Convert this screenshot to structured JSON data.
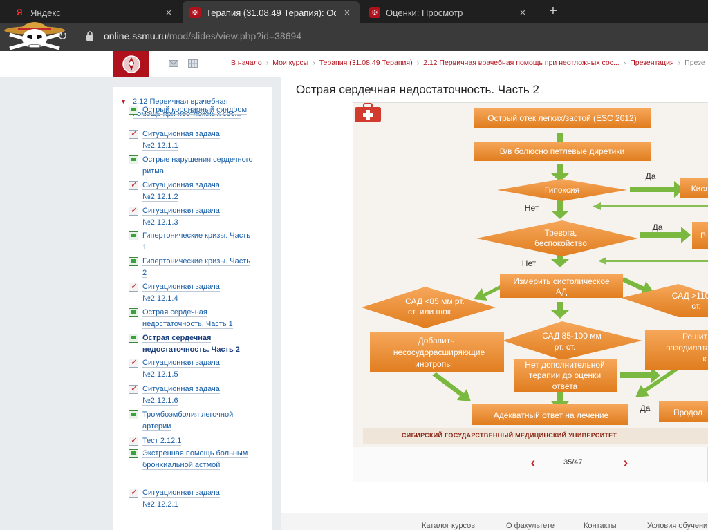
{
  "browser": {
    "tabs": [
      {
        "label": "Яндекс",
        "close": "×"
      },
      {
        "label": "Терапия (31.08.49 Терапия): Ост",
        "close": "×"
      },
      {
        "label": "Оценки: Просмотр",
        "close": "×"
      }
    ],
    "new_tab": "+",
    "url_host": "online.ssmu.ru",
    "url_path": "/mod/slides/view.php?id=38694"
  },
  "breadcrumbs": [
    "В начало",
    "Мои курсы",
    "Терапия (31.08.49 Терапия)",
    "2.12 Первичная врачебная помощь при неотложных сос...",
    "Презентация",
    "Презе"
  ],
  "sidebar": {
    "parent": "2.12 Первичная врачебная помощь при неотложных сос...",
    "items": [
      {
        "type": "slide",
        "label": "Острый коронарный синдром"
      },
      {
        "type": "task",
        "label": "Ситуационная задача №2.12.1.1"
      },
      {
        "type": "slide",
        "label": "Острые нарушения сердечного ритма"
      },
      {
        "type": "task",
        "label": "Ситуационная задача №2.12.1.2"
      },
      {
        "type": "task",
        "label": "Ситуационная задача №2.12.1.3"
      },
      {
        "type": "slide",
        "label": "Гипертонические кризы. Часть 1"
      },
      {
        "type": "slide",
        "label": "Гипертонические кризы. Часть 2"
      },
      {
        "type": "task",
        "label": "Ситуационная задача №2.12.1.4"
      },
      {
        "type": "slide",
        "label": "Острая сердечная недостаточность. Часть 1"
      },
      {
        "type": "slide",
        "label": "Острая сердечная недостаточность. Часть 2",
        "current": true
      },
      {
        "type": "task",
        "label": "Ситуационная задача №2.12.1.5"
      },
      {
        "type": "task",
        "label": "Ситуационная задача №2.12.1.6"
      },
      {
        "type": "slide",
        "label": "Тромбоэмболия легочной артерии"
      },
      {
        "type": "task",
        "label": "Тест 2.12.1"
      },
      {
        "type": "slide",
        "label": "Экстренная помощь больным бронхиальной астмой"
      },
      {
        "type": "task",
        "label": "Ситуационная задача №2.12.2.1"
      }
    ]
  },
  "main": {
    "title": "Острая сердечная недостаточность. Часть 2"
  },
  "slide": {
    "box1": "Острый отек легких/застой (ESC 2012)",
    "box2": "В/в болюсно петлевые диретики",
    "d_hypoxia": "Гипоксия",
    "yes1": "Да",
    "r1": "Кисл",
    "no1": "Нет",
    "d_anxiety_1": "Тревога,",
    "d_anxiety_2": "беспокойство",
    "yes2": "Да",
    "r2": "Р",
    "no2": "Нет",
    "box3_1": "Измерить систолическое",
    "box3_2": "АД",
    "d_left_1": "САД <85 мм рт.",
    "d_left_2": "ст. или шок",
    "d_right_1": "САД >110",
    "d_right_2": "ст.",
    "d_mid_1": "САД 85-100 мм",
    "d_mid_2": "рт. ст.",
    "box_left_1": "Добавить",
    "box_left_2": "несосудорасширяющие",
    "box_left_3": "инотропы",
    "box_right_1": "Решит",
    "box_right_2": "вазодилата",
    "box_right_3": "к",
    "box_mid_1": "Нет дополнительной",
    "box_mid_2": "терапии до оценки",
    "box_mid_3": "ответа",
    "box_bottom": "Адекватный ответ на лечение",
    "yes3": "Да",
    "r3": "Продол",
    "footer": "СИБИРСКИЙ ГОСУДАРСТВЕННЫЙ МЕДИЦИНСКИЙ УНИВЕРСИТЕТ"
  },
  "pager": {
    "prev": "‹",
    "next": "›",
    "count": "35/47"
  },
  "footer_nav": [
    "Каталог курсов",
    "О факультете",
    "Контакты",
    "Условия обучени"
  ]
}
